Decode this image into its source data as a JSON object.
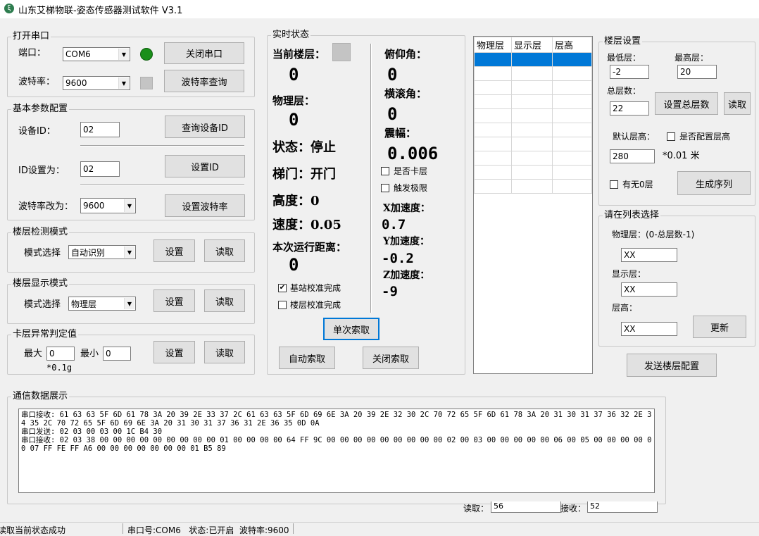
{
  "window": {
    "title": "山东艾梯物联-姿态传感器测试软件 V3.1",
    "icon": "app-logo-icon"
  },
  "serial": {
    "group_title": "打开串口",
    "port_label": "端口：",
    "port_value": "COM6",
    "baud_label": "波特率：",
    "baud_value": "9600",
    "close_button": "关闭串口",
    "query_baud_button": "波特率查询",
    "status_led_color": "#1a8f1a"
  },
  "basic": {
    "group_title": "基本参数配置",
    "device_id_label": "设备ID：",
    "device_id_value": "02",
    "query_id_button": "查询设备ID",
    "set_id_label": "ID设置为：",
    "set_id_value": "02",
    "set_id_button": "设置ID",
    "baud_change_label": "波特率改为：",
    "baud_change_value": "9600",
    "set_baud_button": "设置波特率"
  },
  "floor_detect": {
    "group_title": "楼层检测模式",
    "mode_label": "模式选择",
    "mode_value": "自动识别",
    "set_button": "设置",
    "read_button": "读取"
  },
  "floor_display": {
    "group_title": "楼层显示模式",
    "mode_label": "模式选择",
    "mode_value": "物理层",
    "set_button": "设置",
    "read_button": "读取"
  },
  "stuck": {
    "group_title": "卡层异常判定值",
    "max_label": "最大",
    "max_value": "0",
    "min_label": "最小",
    "min_value": "0",
    "unit": "*0.1g",
    "set_button": "设置",
    "read_button": "读取"
  },
  "realtime": {
    "group_title": "实时状态",
    "current_floor_label": "当前楼层：",
    "current_floor_value": "0",
    "physical_floor_label": "物理层：",
    "physical_floor_value": "0",
    "state_text": "状态：停止",
    "door_text": "梯门：开门",
    "height_text": "高度：0",
    "speed_text": "速度：0.05",
    "distance_label": "本次运行距离：",
    "distance_value": "0",
    "pitch_label": "俯仰角：",
    "pitch_value": "0",
    "roll_label": "横滚角：",
    "roll_value": "0",
    "amplitude_label": "震幅：",
    "amplitude_value": "0.006",
    "stuck_check": "是否卡层",
    "limit_check": "触发极限",
    "x_acc_label": "X加速度：",
    "x_acc_value": "0.7",
    "y_acc_label": "Y加速度：",
    "y_acc_value": "-0.2",
    "z_acc_label": "Z加速度：",
    "z_acc_value": "-9",
    "base_calib_check": "基站校准完成",
    "floor_calib_check": "楼层校准完成",
    "single_fetch_button": "单次索取",
    "auto_fetch_button": "自动索取",
    "stop_fetch_button": "关闭索取"
  },
  "floor_table": {
    "headers": [
      "物理层",
      "显示层",
      "层高"
    ],
    "rows": [
      [
        "",
        "",
        ""
      ],
      [
        "",
        "",
        ""
      ],
      [
        "",
        "",
        ""
      ],
      [
        "",
        "",
        ""
      ],
      [
        "",
        "",
        ""
      ],
      [
        "",
        "",
        ""
      ],
      [
        "",
        "",
        ""
      ],
      [
        "",
        "",
        ""
      ],
      [
        "",
        "",
        ""
      ],
      [
        "",
        "",
        ""
      ]
    ],
    "selected_color": "#0078d7"
  },
  "floor_settings": {
    "group_title": "楼层设置",
    "min_floor_label": "最低层：",
    "min_floor_value": "-2",
    "max_floor_label": "最高层：",
    "max_floor_value": "20",
    "total_label": "总层数：",
    "total_value": "22",
    "set_total_button": "设置总层数",
    "read_button": "读取",
    "default_height_label": "默认层高：",
    "config_height_check": "是否配置层高",
    "default_height_value": "280",
    "height_unit": "*0.01 米",
    "zero_floor_check": "有无0层",
    "generate_button": "生成序列"
  },
  "list_select": {
    "group_title": "请在列表选择",
    "physical_label": "物理层：(0-总层数-1)",
    "physical_value": "XX",
    "display_label": "显示层：",
    "display_value": "XX",
    "height_label": "层高：",
    "height_value": "XX",
    "update_button": "更新"
  },
  "send_config_button": "发送楼层配置",
  "comm": {
    "group_title": "通信数据展示",
    "log_text": "串口接收: 61 63 63 5F 6D 61 78 3A 20 39 2E 33 37 2C 61 63 63 5F 6D 69 6E 3A 20 39 2E 32 30 2C 70 72 65 5F 6D 61 78 3A 20 31 30 31 37 36 32 2E 34 35 2C 70 72 65 5F 6D 69 6E 3A 20 31 30 31 37 36 31 2E 36 35 0D 0A\n串口发送: 02 03 00 03 00 1C B4 30\n串口接收: 02 03 38 00 00 00 00 00 00 00 00 00 01 00 00 00 00 64 FF 9C 00 00 00 00 00 00 00 00 00 02 00 03 00 00 00 00 00 06 00 05 00 00 00 00 00 07 FF FE FF A6 00 00 00 00 00 00 00 01 B5 89",
    "read_label": "读取：",
    "read_count": "56",
    "recv_label": "接收：",
    "recv_count": "52"
  },
  "statusbar": {
    "left": "读取当前状态成功",
    "right": "串口号:COM6   状态:已开启  波特率:9600"
  }
}
